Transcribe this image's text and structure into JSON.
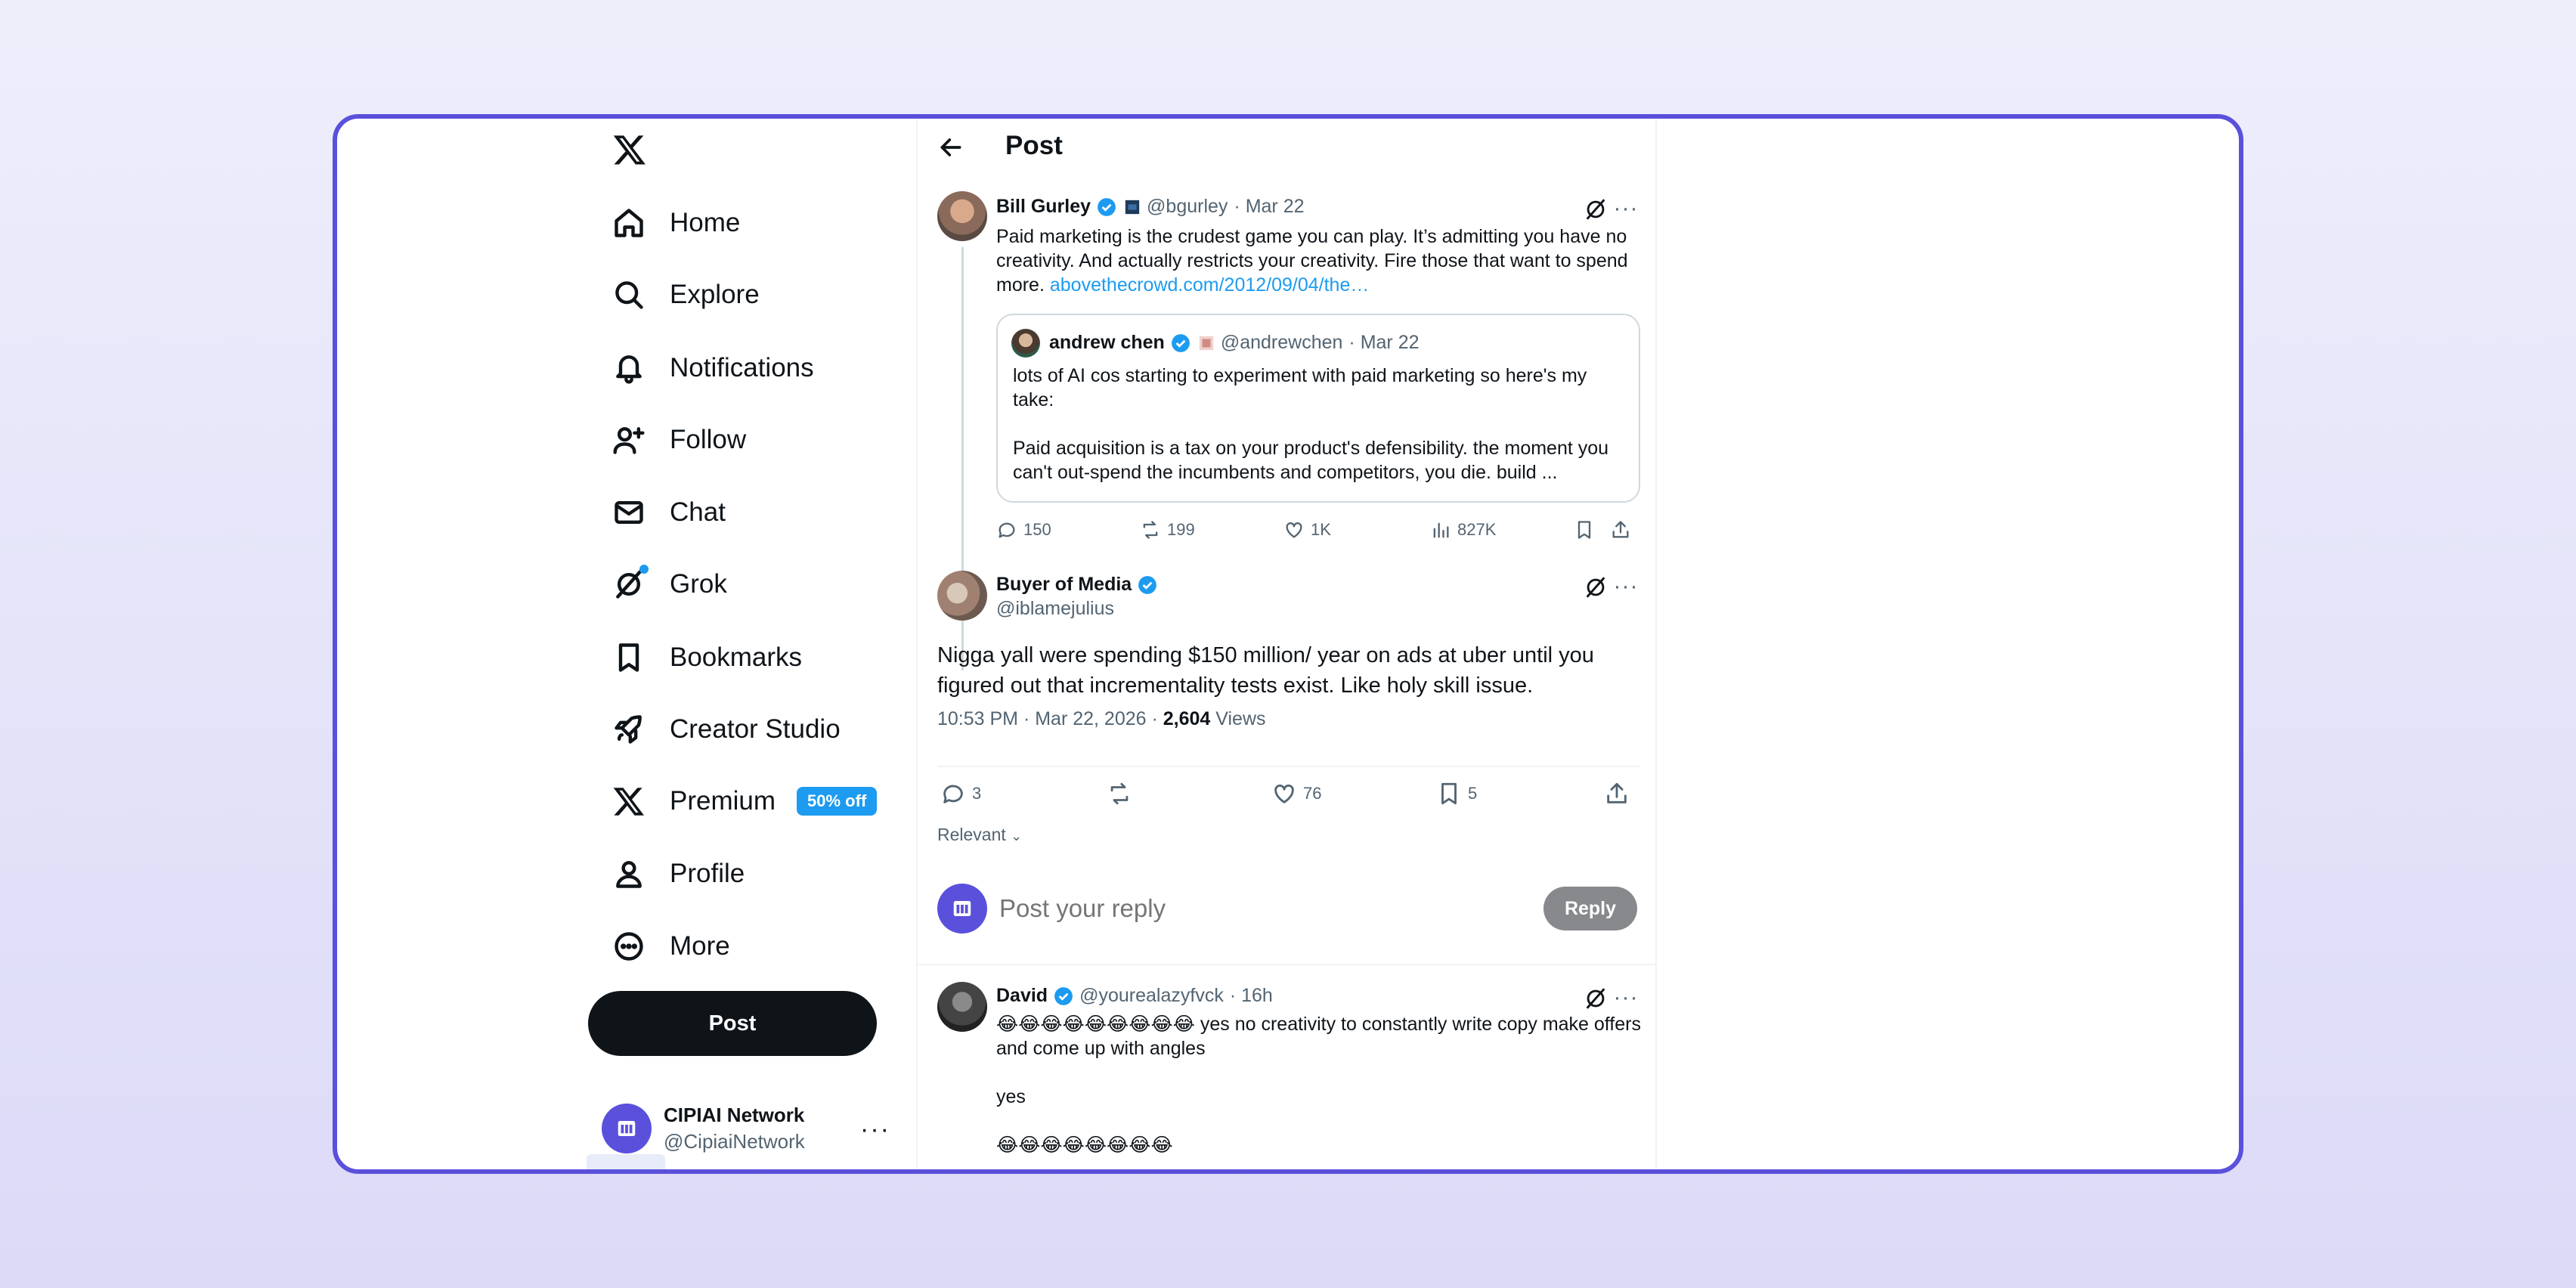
{
  "sidebar": {
    "items": [
      {
        "label": "Home",
        "icon": "home-icon"
      },
      {
        "label": "Explore",
        "icon": "search-icon"
      },
      {
        "label": "Notifications",
        "icon": "bell-icon"
      },
      {
        "label": "Follow",
        "icon": "add-user-icon"
      },
      {
        "label": "Chat",
        "icon": "envelope-icon"
      },
      {
        "label": "Grok",
        "icon": "grok-icon"
      },
      {
        "label": "Bookmarks",
        "icon": "bookmark-icon"
      },
      {
        "label": "Creator Studio",
        "icon": "rocket-icon"
      },
      {
        "label": "Premium",
        "icon": "x-logo-icon"
      },
      {
        "label": "Profile",
        "icon": "person-icon"
      },
      {
        "label": "More",
        "icon": "more-circle-icon"
      }
    ],
    "premium_badge": "50% off",
    "post_button": "Post",
    "account": {
      "name": "CIPIAI Network",
      "handle": "@CipiaiNetwork"
    }
  },
  "header": {
    "title": "Post"
  },
  "parent_post": {
    "name": "Bill Gurley",
    "handle": "@bgurley",
    "date": "· Mar 22",
    "text": "Paid marketing is the crudest game you can play. It’s admitting you have no creativity. And actually restricts your creativity. Fire those that want to spend more.",
    "link": "abovethecrowd.com/2012/09/04/the…",
    "quote": {
      "name": "andrew chen",
      "handle": "@andrewchen",
      "date": "· Mar 22",
      "text1": "lots of AI cos starting to experiment with paid marketing so here's my take:",
      "text2": "Paid acquisition is a tax on your product's defensibility. the moment you can't out-spend the incumbents and competitors, you die. build ..."
    },
    "stats": {
      "replies": "150",
      "reposts": "199",
      "likes": "1K",
      "views": "827K"
    }
  },
  "main_post": {
    "name": "Buyer of Media",
    "handle": "@iblamejulius",
    "text": "Nigga yall were spending $150 million/ year on ads at uber until you figured out that incrementality tests exist. Like holy skill issue.",
    "timestamp": "10:53 PM · Mar 22, 2026 ·",
    "views_count": "2,604",
    "views_label": "Views",
    "stats": {
      "replies": "3",
      "likes": "76",
      "bookmarks": "5"
    }
  },
  "sort": {
    "label": "Relevant"
  },
  "reply_box": {
    "placeholder": "Post your reply",
    "button": "Reply"
  },
  "reply": {
    "name": "David",
    "handle": "@yourealazyfvck",
    "date": "· 16h",
    "line1_emoji": "😂😂😂😂😂😂😂😂😂",
    "line1_text": "yes no creativity to constantly write copy make offers and come up with angles",
    "line2": "yes",
    "line3": "😂😂😂😂😂😂😂😂"
  },
  "colors": {
    "accent": "#1d9bf0",
    "frame": "#5a50dc",
    "text": "#0f1419",
    "muted": "#536471"
  }
}
